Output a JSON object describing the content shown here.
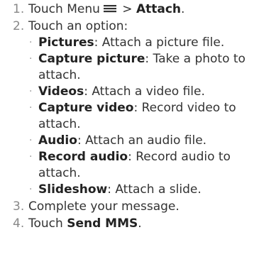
{
  "steps": [
    {
      "number": "1.",
      "pre": "Touch Menu",
      "icon": "menu-icon",
      "mid": " > ",
      "bold": "Attach",
      "post": "."
    },
    {
      "number": "2.",
      "text": "Touch an option:",
      "options": [
        {
          "label": "Pictures",
          "desc": ": Attach a picture file."
        },
        {
          "label": "Capture picture",
          "desc": ": Take a photo to attach."
        },
        {
          "label": "Videos",
          "desc": ": Attach a video file."
        },
        {
          "label": "Capture video",
          "desc": ": Record video to attach."
        },
        {
          "label": "Audio",
          "desc": ": Attach an audio file."
        },
        {
          "label": "Record audio",
          "desc": ": Record audio to attach."
        },
        {
          "label": "Slideshow",
          "desc": ": Attach a slide."
        }
      ]
    },
    {
      "number": "3.",
      "text": "Complete your message."
    },
    {
      "number": "4.",
      "pre": "Touch ",
      "bold": "Send MMS",
      "post": "."
    }
  ],
  "bullet_char": "·"
}
